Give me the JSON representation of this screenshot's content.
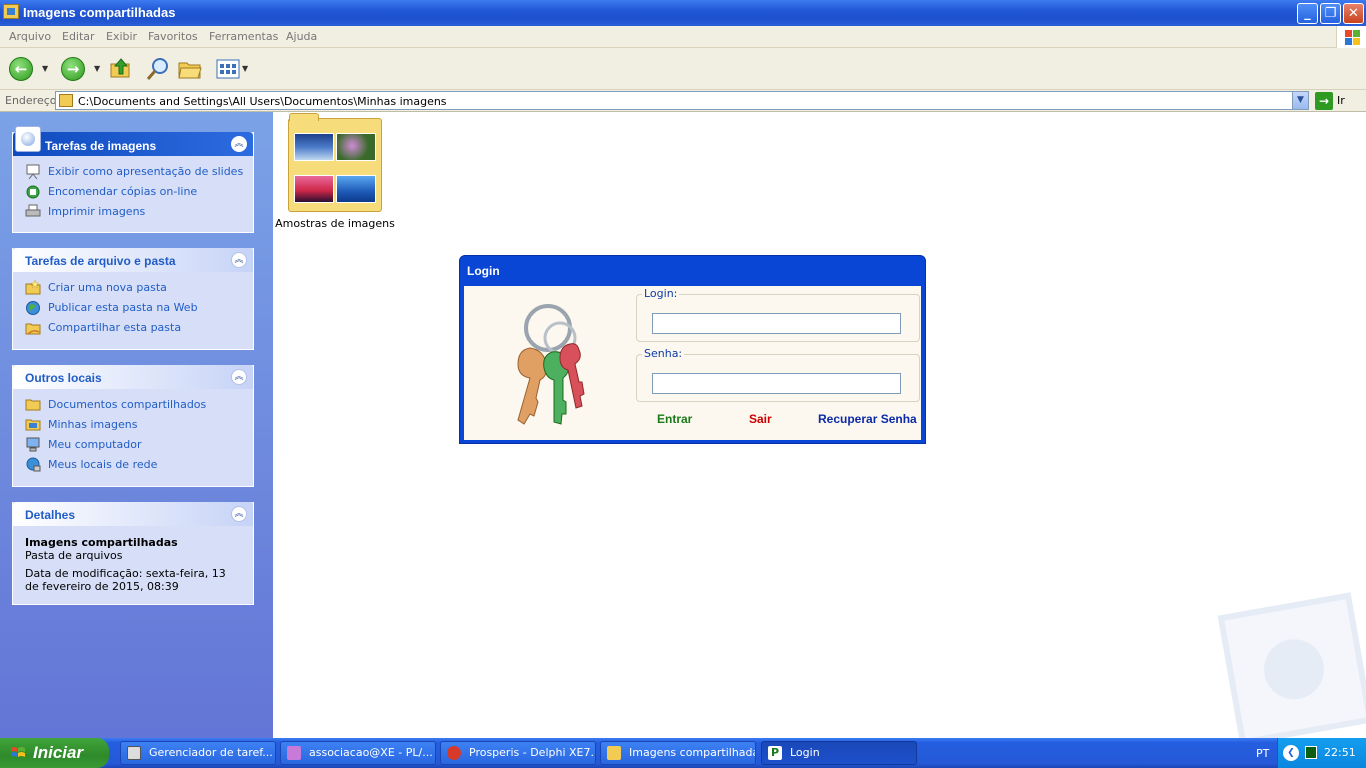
{
  "window": {
    "title": "Imagens compartilhadas",
    "controls": {
      "minimize": "_",
      "maximize": "❐",
      "close": "✕"
    }
  },
  "menu": [
    "Arquivo",
    "Editar",
    "Exibir",
    "Favoritos",
    "Ferramentas",
    "Ajuda"
  ],
  "toolbar": {
    "back_icon": "back-arrow-icon",
    "forward_icon": "forward-arrow-icon",
    "up_icon": "up-folder-icon",
    "search_icon": "search-icon",
    "folders_icon": "folders-icon",
    "views_icon": "views-icon"
  },
  "address": {
    "label": "Endereço",
    "path": "C:\\Documents and Settings\\All Users\\Documentos\\Minhas imagens",
    "go": "Ir"
  },
  "panels": {
    "picture_tasks": {
      "title": "Tarefas de imagens",
      "items": [
        "Exibir como apresentação de slides",
        "Encomendar cópias on-line",
        "Imprimir imagens"
      ]
    },
    "file_tasks": {
      "title": "Tarefas de arquivo e pasta",
      "items": [
        "Criar uma nova pasta",
        "Publicar esta pasta na Web",
        "Compartilhar esta pasta"
      ]
    },
    "other_places": {
      "title": "Outros locais",
      "items": [
        "Documentos compartilhados",
        "Minhas imagens",
        "Meu computador",
        "Meus locais de rede"
      ]
    },
    "details": {
      "title": "Detalhes",
      "name": "Imagens compartilhadas",
      "type": "Pasta de arquivos",
      "modified": "Data de modificação: sexta-feira, 13 de fevereiro de 2015, 08:39"
    }
  },
  "content": {
    "folder_label": "Amostras de imagens"
  },
  "login_dialog": {
    "title": "Login",
    "login_label": "Login:",
    "password_label": "Senha:",
    "login_value": "",
    "password_value": "",
    "enter": "Entrar",
    "exit": "Sair",
    "recover": "Recuperar Senha"
  },
  "taskbar": {
    "start": "Iniciar",
    "tasks": [
      {
        "label": "Gerenciador de taref...",
        "active": false
      },
      {
        "label": "associacao@XE - PL/...",
        "active": false
      },
      {
        "label": "Prosperis - Delphi XE7...",
        "active": false
      },
      {
        "label": "Imagens compartilhadas",
        "active": false
      },
      {
        "label": "Login",
        "active": true
      }
    ],
    "language": "PT",
    "clock": "22:51"
  },
  "colors": {
    "titlebar": "#2258d6",
    "taskpane": "#7ba2e7",
    "link": "#215dc6",
    "enter": "#1a7a1a",
    "exit": "#cc0000",
    "recover": "#0b2aa8"
  }
}
